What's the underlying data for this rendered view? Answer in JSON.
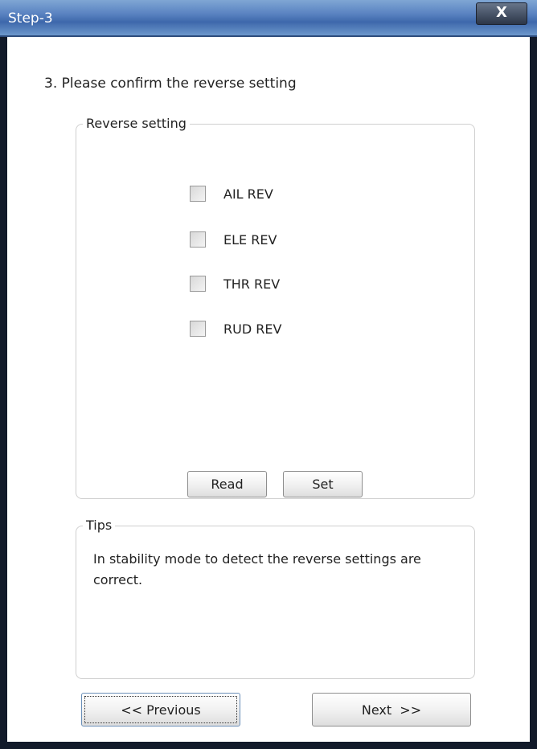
{
  "window": {
    "title": "Step-3",
    "close_label": "X"
  },
  "heading": "3. Please confirm the reverse setting",
  "reverse_group": {
    "legend": "Reverse setting",
    "options": [
      {
        "label": "AIL REV",
        "checked": false
      },
      {
        "label": "ELE REV",
        "checked": false
      },
      {
        "label": "THR REV",
        "checked": false
      },
      {
        "label": "RUD REV",
        "checked": false
      }
    ],
    "read_label": "Read",
    "set_label": "Set"
  },
  "tips_group": {
    "legend": "Tips",
    "text": "In stability mode to detect the reverse settings are correct."
  },
  "nav": {
    "previous_label": "<< Previous",
    "next_label": "Next  >>"
  }
}
